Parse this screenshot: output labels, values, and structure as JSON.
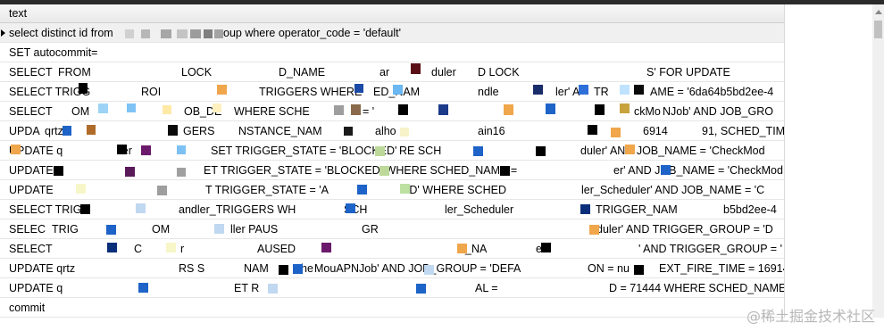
{
  "grid": {
    "header": "text",
    "rows": [
      "select distinct id from",
      "oup where operator_code = 'default'",
      "SET autocommit=",
      "SELECT",
      "FROM",
      "LOCK",
      "D_NAME",
      "ar",
      "duler",
      "D LOCK",
      "S' FOR UPDATE",
      "SELECT TRIGG",
      "ROI",
      "TRIGGERS WHERE",
      "ED_NAM",
      "ndle",
      "ler' A",
      "TR",
      "AME = '6da64b5bd2ee-4",
      "SELECT",
      "OM",
      "OB_DE",
      "WHERE SCHE",
      "= '",
      "ckMo",
      "NJob' AND JOB_GRO",
      "UPDA",
      "qrtz",
      "GERS",
      "NSTANCE_NAM",
      "alho",
      "ain16",
      "6914",
      "91, SCHED_TIM",
      "UPDATE q",
      "ler",
      "SET TRIGGER_STATE = 'BLOCKED'",
      "RE SCH",
      "duler' AND JOB_NAME = 'CheckMod",
      "UPDATE",
      "ET TRIGGER_STATE = 'BLOCKED' WHERE SCHED_NAME =",
      "er' AND JOB_NAME = 'CheckMod",
      "UPDATE",
      "T TRIGGER_STATE = 'A",
      "ED' WHERE SCHED",
      "ler_Scheduler' AND JOB_NAME = 'C",
      "SELECT TRIG",
      "andler_TRIGGERS WH",
      "SCH",
      "ler_Scheduler",
      "TRIGGER_NAM",
      "b5bd2ee-4",
      "SELEC",
      "TRIG",
      "OM",
      "ller PAUS",
      "GR",
      "duler' AND TRIGGER_GROUP = 'D",
      "SELECT",
      "C",
      "r",
      "AUSED",
      "D_NA",
      "ell",
      "' AND TRIGGER_GROUP = '",
      "UPDATE qrtz",
      "RS S",
      "NAM",
      "Che",
      "MouAPNJob' AND JOB_GROUP = 'DEFA",
      "ON = nu",
      "EXT_FIRE_TIME = 16914",
      "UPDATE q",
      "ET R",
      "AL =",
      "D = 71444 WHERE SCHED_NAME",
      "commit"
    ]
  },
  "watermark": "@稀土掘金技术社区"
}
